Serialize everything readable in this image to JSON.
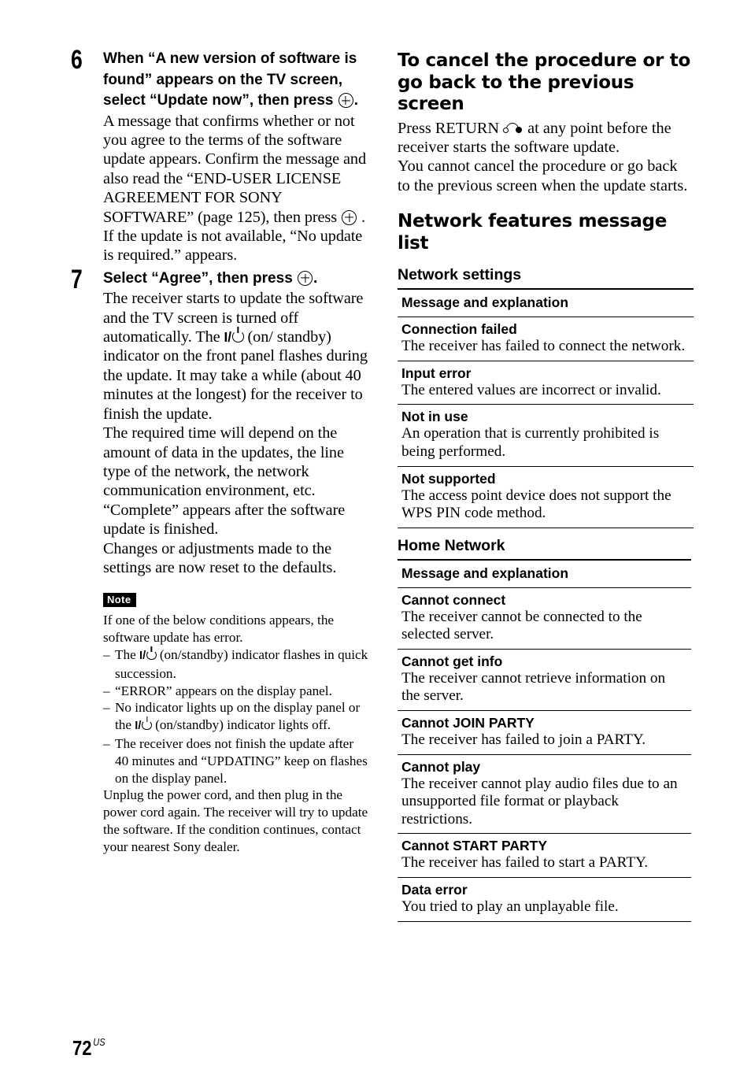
{
  "left": {
    "step6": {
      "number": "6",
      "title_pre": "When “A new version of software is found” appears on the TV screen, select “Update now”, then press ",
      "title_post": ".",
      "body1_pre": "A message that confirms whether or not you agree to the terms of the software update appears. Confirm the message and also read the “END-USER LICENSE AGREEMENT FOR SONY SOFTWARE” (page 125), then press ",
      "body1_post": " .",
      "body2": "If the update is not available, “No update is required.” appears."
    },
    "step7": {
      "number": "7",
      "title_pre": "Select “Agree”, then press ",
      "title_post": ".",
      "body1_pre": "The receiver starts to update the software and the TV screen is turned off automatically. The ",
      "power_label": "I/",
      "body1_post": " (on/ standby) indicator on the front panel flashes during the update. It may take a while (about 40 minutes at the longest) for the receiver to finish the update.",
      "body2": "The required time will depend on the amount of data in the updates, the line type of the network, the network communication environment, etc.",
      "body3": "“Complete” appears after the software update is finished.",
      "body4": "Changes or adjustments made to the settings are now reset to the defaults."
    },
    "note": {
      "badge": "Note",
      "intro": "If one of the below conditions appears, the software update has error.",
      "items": [
        {
          "pre": "The ",
          "power": "I/",
          "post": " (on/standby) indicator flashes in quick succession."
        },
        {
          "pre": "“ERROR” appears on the display panel.",
          "power": "",
          "post": ""
        },
        {
          "pre": "No indicator lights up on the display panel or the ",
          "power": "I/",
          "post": " (on/standby) indicator lights off."
        },
        {
          "pre": "The receiver does not finish the update after 40 minutes and “UPDATING” keep on flashes on the display panel.",
          "power": "",
          "post": ""
        }
      ],
      "outro": "Unplug the power cord, and then plug in the power cord again. The receiver will try to update the software. If the condition continues, contact your nearest Sony dealer."
    }
  },
  "right": {
    "cancel": {
      "heading": "To cancel the procedure or to go back to the previous screen",
      "p1_pre": "Press RETURN ",
      "p1_post": " at any point before the receiver starts the software update.",
      "p2": "You cannot cancel the procedure or go back to the previous screen when the update starts."
    },
    "message_list": {
      "heading": "Network features message list",
      "network_settings": {
        "heading": "Network settings",
        "column_header": "Message and explanation",
        "rows": [
          {
            "message": "Connection failed",
            "explanation": "The receiver has failed to connect the network."
          },
          {
            "message": "Input error",
            "explanation": "The entered values are incorrect or invalid."
          },
          {
            "message": "Not in use",
            "explanation": "An operation that is currently prohibited is being performed."
          },
          {
            "message": "Not supported",
            "explanation": "The access point device does not support the WPS PIN code method."
          }
        ]
      },
      "home_network": {
        "heading": "Home Network",
        "column_header": "Message and explanation",
        "rows": [
          {
            "message": "Cannot connect",
            "explanation": "The receiver cannot be connected to the selected server."
          },
          {
            "message": "Cannot get info",
            "explanation": "The receiver cannot retrieve information on the server."
          },
          {
            "message": "Cannot JOIN PARTY",
            "explanation": "The receiver has failed to join a PARTY."
          },
          {
            "message": "Cannot play",
            "explanation": "The receiver cannot play audio files due to an unsupported file format or playback restrictions."
          },
          {
            "message": "Cannot START PARTY",
            "explanation": "The receiver has failed to start a PARTY."
          },
          {
            "message": "Data error",
            "explanation": "You tried to play an unplayable file."
          }
        ]
      }
    }
  },
  "footer": {
    "page_number": "72",
    "page_suffix": "US"
  }
}
